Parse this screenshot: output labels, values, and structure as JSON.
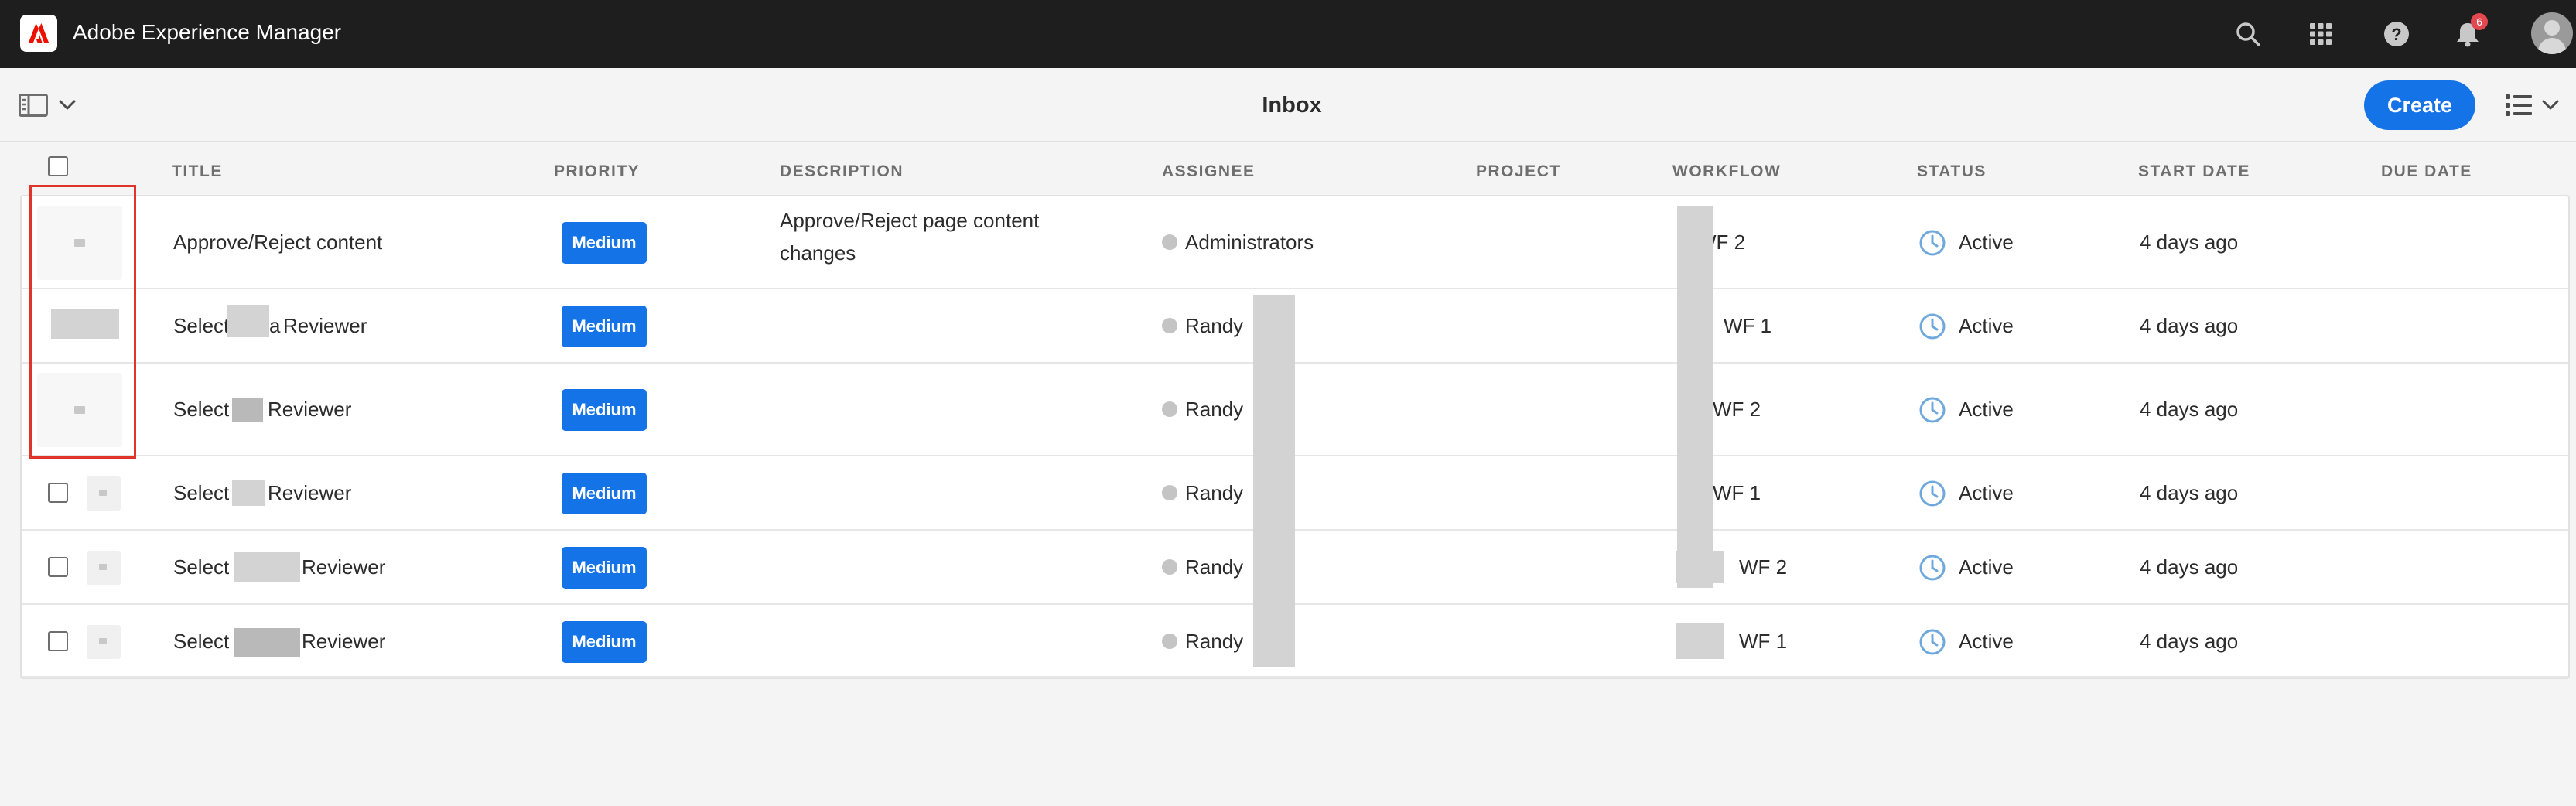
{
  "app": {
    "title": "Adobe Experience Manager",
    "notification_count": "6"
  },
  "toolbar": {
    "page_title": "Inbox",
    "create_label": "Create"
  },
  "table": {
    "headers": {
      "title": "TITLE",
      "priority": "PRIORITY",
      "description": "DESCRIPTION",
      "assignee": "ASSIGNEE",
      "project": "PROJECT",
      "workflow": "WORKFLOW",
      "status": "STATUS",
      "start_date": "START DATE",
      "due_date": "DUE DATE"
    },
    "rows": [
      {
        "title": "Approve/Reject content",
        "priority": "Medium",
        "description_line1": "Approve/Reject page content",
        "description_line2": "changes",
        "assignee": "Administrators",
        "workflow": "WF 2",
        "status": "Active",
        "start_date": "4 days ago"
      },
      {
        "title_pre": "Select",
        "title_mid": "a",
        "title_post": "Reviewer",
        "priority": "Medium",
        "assignee": "Randy",
        "workflow": "WF 1",
        "status": "Active",
        "start_date": "4 days ago"
      },
      {
        "title_pre": "Select",
        "title_post": "Reviewer",
        "priority": "Medium",
        "assignee": "Randy",
        "workflow": "WF 2",
        "status": "Active",
        "start_date": "4 days ago"
      },
      {
        "title_pre": "Select",
        "title_post": "Reviewer",
        "priority": "Medium",
        "assignee": "Randy",
        "workflow": "WF 1",
        "status": "Active",
        "start_date": "4 days ago"
      },
      {
        "title_pre": "Select",
        "title_post": "Reviewer",
        "priority": "Medium",
        "assignee": "Randy",
        "workflow": "WF 2",
        "status": "Active",
        "start_date": "4 days ago"
      },
      {
        "title_pre": "Select",
        "title_post": "Reviewer",
        "priority": "Medium",
        "assignee": "Randy",
        "workflow": "WF 1",
        "status": "Active",
        "start_date": "4 days ago"
      }
    ]
  },
  "colors": {
    "accent": "#1473e6",
    "topbar": "#1e1e1e",
    "highlight": "#e0342b",
    "badge": "#e34850"
  },
  "icons": [
    "adobe-logo-icon",
    "search-icon",
    "apps-grid-icon",
    "help-icon",
    "bell-icon",
    "avatar",
    "rail-toggle-icon",
    "chevron-down-icon",
    "list-view-icon",
    "clock-icon"
  ]
}
